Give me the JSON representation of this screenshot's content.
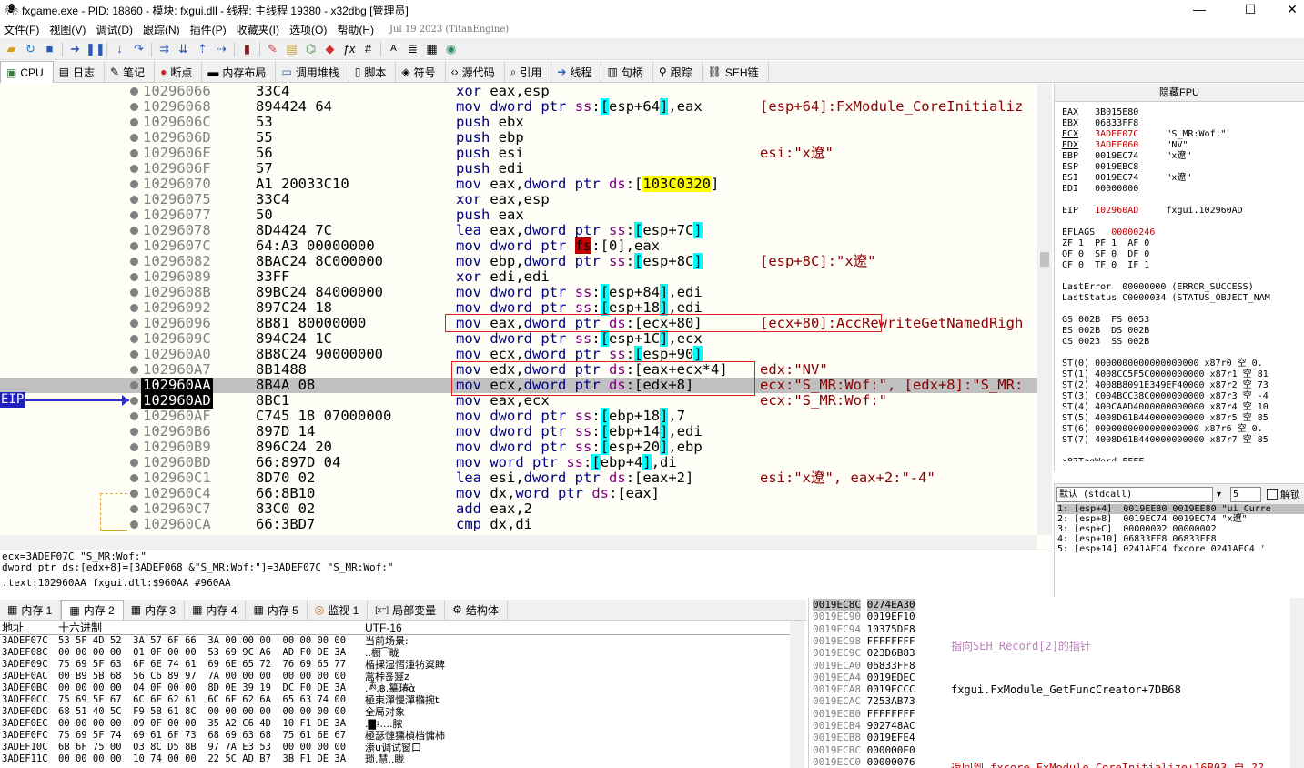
{
  "window": {
    "title": "fxgame.exe - PID: 18860 - 模块: fxgui.dll - 线程: 主线程 19380 - x32dbg [管理员]",
    "minimize": "—",
    "maximize": "☐",
    "close": "✕"
  },
  "menu": {
    "items": [
      "文件(F)",
      "视图(V)",
      "调试(D)",
      "跟踪(N)",
      "插件(P)",
      "收藏夹(I)",
      "选项(O)",
      "帮助(H)"
    ],
    "date": "Jul 19 2023 (TitanEngine)"
  },
  "tabs": [
    {
      "label": "CPU",
      "icon": "cpu-icon",
      "active": true
    },
    {
      "label": "日志",
      "icon": "log-icon"
    },
    {
      "label": "笔记",
      "icon": "notes-icon"
    },
    {
      "label": "断点",
      "icon": "breakpoint-icon"
    },
    {
      "label": "内存布局",
      "icon": "memory-map-icon"
    },
    {
      "label": "调用堆栈",
      "icon": "call-stack-icon"
    },
    {
      "label": "脚本",
      "icon": "script-icon"
    },
    {
      "label": "符号",
      "icon": "symbols-icon"
    },
    {
      "label": "源代码",
      "icon": "source-icon"
    },
    {
      "label": "引用",
      "icon": "references-icon"
    },
    {
      "label": "线程",
      "icon": "threads-icon"
    },
    {
      "label": "句柄",
      "icon": "handles-icon"
    },
    {
      "label": "跟踪",
      "icon": "trace-icon"
    },
    {
      "label": "SEH链",
      "icon": "seh-icon"
    }
  ],
  "disasm": {
    "eip_label": "EIP",
    "rows": [
      {
        "addr": "10296066",
        "bytes": "33C4",
        "dis": "xor eax,esp",
        "cmt": ""
      },
      {
        "addr": "10296068",
        "bytes": "894424 64",
        "dis": "mov dword ptr ss:[esp+64],eax",
        "cmt": "[esp+64]:FxModule_CoreInitializ"
      },
      {
        "addr": "1029606C",
        "bytes": "53",
        "dis": "push ebx",
        "cmt": ""
      },
      {
        "addr": "1029606D",
        "bytes": "55",
        "dis": "push ebp",
        "cmt": ""
      },
      {
        "addr": "1029606E",
        "bytes": "56",
        "dis": "push esi",
        "cmt": "esi:\"x遼\""
      },
      {
        "addr": "1029606F",
        "bytes": "57",
        "dis": "push edi",
        "cmt": ""
      },
      {
        "addr": "10296070",
        "bytes": "A1 20033C10",
        "dis": "mov eax,dword ptr ds:[103C0320]",
        "cmt": ""
      },
      {
        "addr": "10296075",
        "bytes": "33C4",
        "dis": "xor eax,esp",
        "cmt": ""
      },
      {
        "addr": "10296077",
        "bytes": "50",
        "dis": "push eax",
        "cmt": ""
      },
      {
        "addr": "10296078",
        "bytes": "8D4424 7C",
        "dis": "lea eax,dword ptr ss:[esp+7C]",
        "cmt": ""
      },
      {
        "addr": "1029607C",
        "bytes": "64:A3 00000000",
        "dis": "mov dword ptr fs:[0],eax",
        "cmt": ""
      },
      {
        "addr": "10296082",
        "bytes": "8BAC24 8C000000",
        "dis": "mov ebp,dword ptr ss:[esp+8C]",
        "cmt": "[esp+8C]:\"x遼\""
      },
      {
        "addr": "10296089",
        "bytes": "33FF",
        "dis": "xor edi,edi",
        "cmt": ""
      },
      {
        "addr": "1029608B",
        "bytes": "89BC24 84000000",
        "dis": "mov dword ptr ss:[esp+84],edi",
        "cmt": ""
      },
      {
        "addr": "10296092",
        "bytes": "897C24 18",
        "dis": "mov dword ptr ss:[esp+18],edi",
        "cmt": ""
      },
      {
        "addr": "10296096",
        "bytes": "8B81 80000000",
        "dis": "mov eax,dword ptr ds:[ecx+80]",
        "cmt": "[ecx+80]:AccRewriteGetNamedRigh"
      },
      {
        "addr": "1029609C",
        "bytes": "894C24 1C",
        "dis": "mov dword ptr ss:[esp+1C],ecx",
        "cmt": ""
      },
      {
        "addr": "102960A0",
        "bytes": "8B8C24 90000000",
        "dis": "mov ecx,dword ptr ss:[esp+90]",
        "cmt": ""
      },
      {
        "addr": "102960A7",
        "bytes": "8B1488",
        "dis": "mov edx,dword ptr ds:[eax+ecx*4]",
        "cmt": "edx:\"NV\""
      },
      {
        "addr": "102960AA",
        "bytes": "8B4A 08",
        "dis": "mov ecx,dword ptr ds:[edx+8]",
        "cmt": "ecx:\"S_MR:Wof:\", [edx+8]:\"S_MR:"
      },
      {
        "addr": "102960AD",
        "bytes": "8BC1",
        "dis": "mov eax,ecx",
        "cmt": "ecx:\"S_MR:Wof:\""
      },
      {
        "addr": "102960AF",
        "bytes": "C745 18 07000000",
        "dis": "mov dword ptr ss:[ebp+18],7",
        "cmt": ""
      },
      {
        "addr": "102960B6",
        "bytes": "897D 14",
        "dis": "mov dword ptr ss:[ebp+14],edi",
        "cmt": ""
      },
      {
        "addr": "102960B9",
        "bytes": "896C24 20",
        "dis": "mov dword ptr ss:[esp+20],ebp",
        "cmt": ""
      },
      {
        "addr": "102960BD",
        "bytes": "66:897D 04",
        "dis": "mov word ptr ss:[ebp+4],di",
        "cmt": ""
      },
      {
        "addr": "102960C1",
        "bytes": "8D70 02",
        "dis": "lea esi,dword ptr ds:[eax+2]",
        "cmt": "esi:\"x遼\", eax+2:\"-4\""
      },
      {
        "addr": "102960C4",
        "bytes": "66:8B10",
        "dis": "mov dx,word ptr ds:[eax]",
        "cmt": ""
      },
      {
        "addr": "102960C7",
        "bytes": "83C0 02",
        "dis": "add eax,2",
        "cmt": ""
      },
      {
        "addr": "102960CA",
        "bytes": "66:3BD7",
        "dis": "cmp dx,di",
        "cmt": ""
      }
    ]
  },
  "info": {
    "line1": "ecx=3ADEF07C \"S_MR:Wof:\"",
    "line2": "dword ptr ds:[edx+8]=[3ADEF068 &\"S_MR:Wof:\"]=3ADEF07C \"S_MR:Wof:\"",
    "line3": ".text:102960AA fxgui.dll:$960AA #960AA"
  },
  "registers": {
    "header": "隐藏FPU",
    "lines": [
      "EAX   3B015E80",
      "EBX   06833FF8",
      "ECX   3ADEF07C     \"S_MR:Wof:\"",
      "EDX   3ADEF060     \"NV\"",
      "EBP   0019EC74     \"x遼\"",
      "ESP   0019EBC8",
      "ESI   0019EC74     \"x遼\"",
      "EDI   00000000",
      "",
      "EIP   102960AD     fxgui.102960AD",
      "",
      "EFLAGS   00000246",
      "ZF 1  PF 1  AF 0",
      "OF 0  SF 0  DF 0",
      "CF 0  TF 0  IF 1",
      "",
      "LastError  00000000 (ERROR_SUCCESS)",
      "LastStatus C0000034 (STATUS_OBJECT_NAM",
      "",
      "GS 002B  FS 0053",
      "ES 002B  DS 002B",
      "CS 0023  SS 002B",
      "",
      "ST(0) 0000000000000000000 x87r0 空 0.",
      "ST(1) 4008CC5F5C0000000000 x87r1 空 81",
      "ST(2) 4008B8091E349EF40000 x87r2 空 73",
      "ST(3) C004BCC38C0000000000 x87r3 空 -4",
      "ST(4) 400CAAD4000000000000 x87r4 空 10",
      "ST(5) 4008D61B440000000000 x87r5 空 85",
      "ST(6) 0000000000000000000 x87r6 空 0.",
      "ST(7) 4008D61B440000000000 x87r7 空 85",
      "",
      "x87TagWord FFFF"
    ]
  },
  "callstack": {
    "convention": "默认 (stdcall)",
    "count": "5",
    "unlock_label": "解锁",
    "lines": [
      "1: [esp+4]  0019EE80 0019EE80 \"ui_Curre",
      "2: [esp+8]  0019EC74 0019EC74 \"x遼\"",
      "3: [esp+C]  00000002 00000002",
      "4: [esp+10] 06833FF8 06833FF8",
      "5: [esp+14] 0241AFC4 fxcore.0241AFC4 '"
    ]
  },
  "bottom_tabs": [
    {
      "label": "内存 1",
      "icon": "memory-icon"
    },
    {
      "label": "内存 2",
      "icon": "memory-icon",
      "active": true
    },
    {
      "label": "内存 3",
      "icon": "memory-icon"
    },
    {
      "label": "内存 4",
      "icon": "memory-icon"
    },
    {
      "label": "内存 5",
      "icon": "memory-icon"
    },
    {
      "label": "监视 1",
      "icon": "watch-icon"
    },
    {
      "label": "局部变量",
      "icon": "locals-icon"
    },
    {
      "label": "结构体",
      "icon": "struct-icon"
    }
  ],
  "dump": {
    "col_addr": "地址",
    "col_hex": "十六进制",
    "col_text": "UTF-16",
    "rows": [
      {
        "a": "3ADEF07C",
        "h": "53 5F 4D 52  3A 57 6F 66  3A 00 00 00  00 00 00 00",
        "t": "当前场景:"
      },
      {
        "a": "3ADEF08C",
        "h": "00 00 00 00  01 0F 00 00  53 69 9C A6  AD F0 DE 3A",
        "t": "..橱⁀眬"
      },
      {
        "a": "3ADEF09C",
        "h": "75 69 5F 63  6F 6E 74 61  69 6E 65 72  76 69 65 77",
        "t": "楯捰湿慴湩牥楶睥"
      },
      {
        "a": "3ADEF0AC",
        "h": "00 B9 5B 68  56 C6 89 97  7A 00 00 00  00 00 00 00",
        "t": "蒿桛흖靋z"
      },
      {
        "a": "3ADEF0BC",
        "h": "00 00 00 00  04 0F 00 00  8D 0E 39 19  DC F0 DE 3A",
        "t": ".ༀ.฿.䵵瑃ὰ"
      },
      {
        "a": "3ADEF0CC",
        "h": "75 69 5F 67  6C 6F 62 61  6C 6F 62 6A  65 63 74 00",
        "t": "極束潬慢潬橢捥t"
      },
      {
        "a": "3ADEF0DC",
        "h": "68 51 40 5C  F9 5B 61 8C  00 00 00 00  00 00 00 00",
        "t": "全局对象"
      },
      {
        "a": "3ADEF0EC",
        "h": "00 00 00 00  09 0F 00 00  35 A2 C6 4D  10 F1 DE 3A",
        "t": ".▇፤....脓"
      },
      {
        "a": "3ADEF0FC",
        "h": "75 69 5F 74  69 61 6F 73  68 69 63 68  75 61 6E 67",
        "t": "極瑟慩獯楨档慵杮"
      },
      {
        "a": "3ADEF10C",
        "h": "6B 6F 75 00  03 8C D5 8B  97 7A E3 53  00 00 00 00",
        "t": "潫u调试窗口"
      },
      {
        "a": "3ADEF11C",
        "h": "00 00 00 00  10 74 00 00  22 5C AD B7  3B F1 DE 3A",
        "t": "琐.慧..眬"
      }
    ]
  },
  "stack": {
    "rows": [
      {
        "a": "0019EC8C",
        "v": "0274EA30"
      },
      {
        "a": "0019EC90",
        "v": "0019EF10"
      },
      {
        "a": "0019EC94",
        "v": "10375DF8"
      },
      {
        "a": "0019EC98",
        "v": "FFFFFFFF"
      },
      {
        "a": "0019EC9C",
        "v": "023D6B83"
      },
      {
        "a": "0019ECA0",
        "v": "06833FF8"
      },
      {
        "a": "0019ECA4",
        "v": "0019EDEC"
      },
      {
        "a": "0019ECA8",
        "v": "0019ECCC"
      },
      {
        "a": "0019ECAC",
        "v": "7253AB73"
      },
      {
        "a": "0019ECB0",
        "v": "FFFFFFFF"
      },
      {
        "a": "0019ECB4",
        "v": "902748AC"
      },
      {
        "a": "0019ECB8",
        "v": "0019EFE4"
      },
      {
        "a": "0019ECBC",
        "v": "000000E0"
      },
      {
        "a": "0019ECC0",
        "v": "00000076"
      }
    ],
    "cmt1": "指向SEH_Record[2]的指针",
    "cmt2": "fxgui.FxModule_GetFuncCreator+7DB68",
    "cmt3": "返回到 fxcore.FxModule_CoreInitialize+16B03 自 ??"
  }
}
